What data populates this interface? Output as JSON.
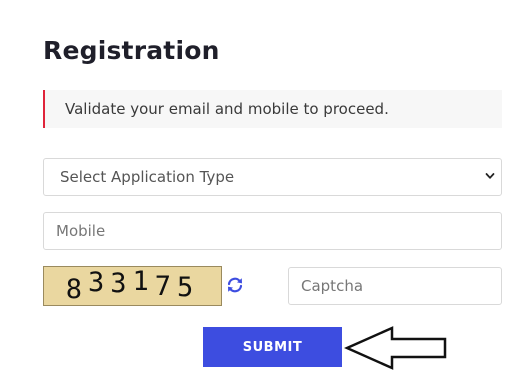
{
  "form": {
    "title": "Registration",
    "notice": "Validate your email and mobile to proceed.",
    "application_type": {
      "selected": "Select Application Type"
    },
    "mobile": {
      "placeholder": "Mobile"
    },
    "captcha": {
      "code_chars": [
        "8",
        "3",
        "3",
        "1",
        "7",
        "5"
      ],
      "placeholder": "Captcha",
      "refresh_icon": "refresh-icon"
    },
    "submit_label": "SUBMIT"
  },
  "colors": {
    "accent_red": "#e0243a",
    "button_blue": "#3d4de0",
    "captcha_bg": "#ead7a0"
  },
  "icons": {
    "chevron": "chevron-down-icon",
    "pointer_arrow": "arrow-left-icon"
  }
}
